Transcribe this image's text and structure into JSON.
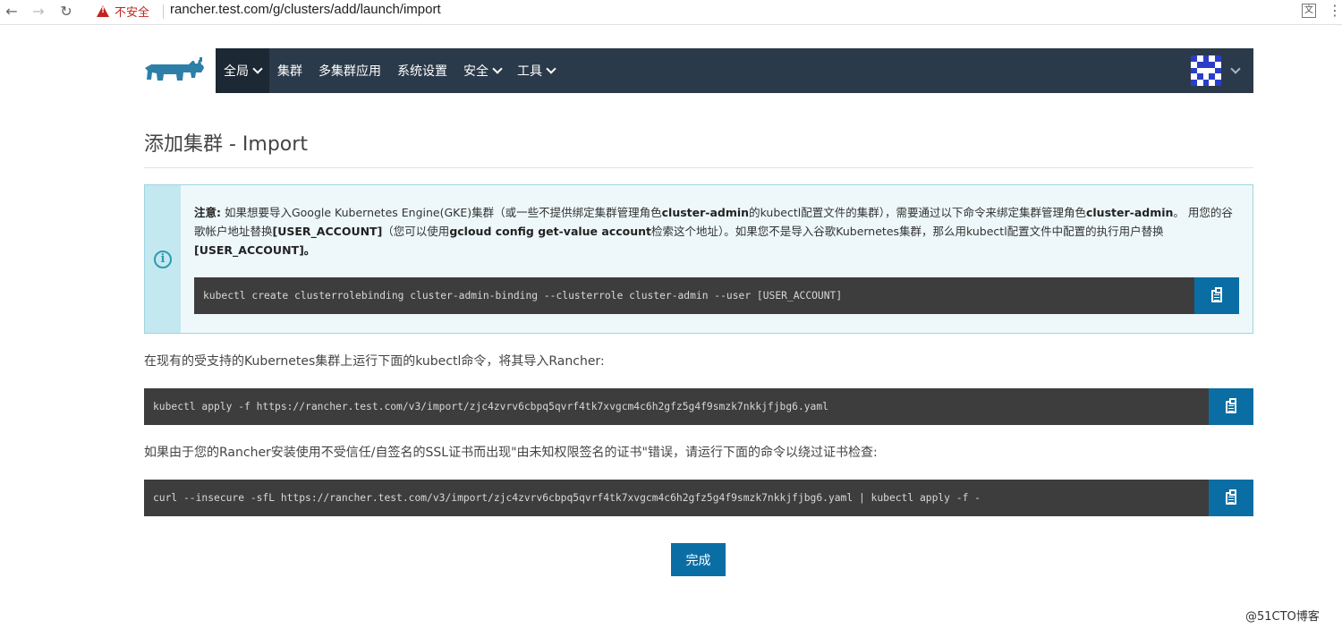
{
  "browser": {
    "security_label": "不安全",
    "url": "rancher.test.com/g/clusters/add/launch/import"
  },
  "header": {
    "nav": [
      {
        "label": "全局",
        "dropdown": true
      },
      {
        "label": "集群",
        "dropdown": false
      },
      {
        "label": "多集群应用",
        "dropdown": false
      },
      {
        "label": "系统设置",
        "dropdown": false
      },
      {
        "label": "安全",
        "dropdown": true
      },
      {
        "label": "工具",
        "dropdown": true
      }
    ]
  },
  "page": {
    "title": "添加集群 - Import"
  },
  "banner": {
    "t1": "注意:",
    "t2": " 如果想要导入Google Kubernetes Engine(GKE)集群（或一些不提供绑定集群管理角色",
    "t3": "cluster-admin",
    "t4": "的kubectl配置文件的集群），需要通过以下命令来绑定集群管理角色",
    "t5": "cluster-admin",
    "t6": "。 用您的谷歌帐户地址替换",
    "t7": "[USER_ACCOUNT]",
    "t8": "（您可以使用",
    "t9": "gcloud config get-value account",
    "t10": "检索这个地址）。如果您不是导入谷歌Kubernetes集群，那么用kubectl配置文件中配置的执行用户替换",
    "t11": "[USER_ACCOUNT]",
    "t12": "。",
    "command": "kubectl create clusterrolebinding cluster-admin-binding --clusterrole cluster-admin --user [USER_ACCOUNT]"
  },
  "step1": {
    "text": "在现有的受支持的Kubernetes集群上运行下面的kubectl命令，将其导入Rancher:",
    "command": "kubectl apply -f https://rancher.test.com/v3/import/zjc4zvrv6cbpq5qvrf4tk7xvgcm4c6h2gfz5g4f9smzk7nkkjfjbg6.yaml"
  },
  "step2": {
    "text": "如果由于您的Rancher安装使用不受信任/自签名的SSL证书而出现\"由未知权限签名的证书\"错误，请运行下面的命令以绕过证书检查:",
    "command": "curl --insecure -sfL https://rancher.test.com/v3/import/zjc4zvrv6cbpq5qvrf4tk7xvgcm4c6h2gfz5g4f9smzk7nkkjfjbg6.yaml | kubectl apply -f -"
  },
  "done_label": "完成",
  "watermark": "@51CTO博客",
  "colors": {
    "header_bg": "#2b3a4a",
    "primary": "#0a6ea5",
    "banner_bg": "#eef8fa",
    "banner_border": "#9fd6e0",
    "code_bg": "#3d3d3d"
  }
}
